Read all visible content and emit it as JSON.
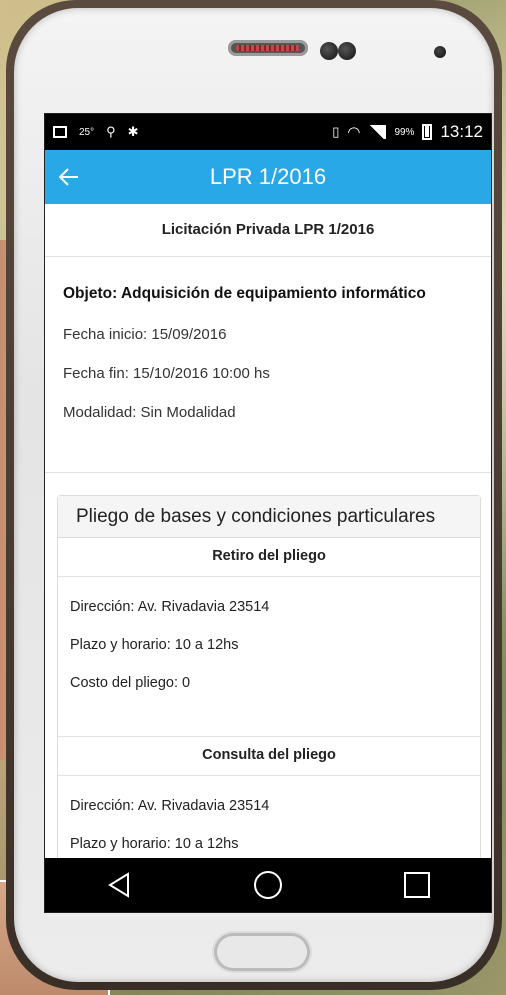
{
  "statusbar": {
    "temp": "25°",
    "battery": "99%",
    "time": "13:12"
  },
  "appbar": {
    "title": "LPR 1/2016"
  },
  "header": {
    "subtitle": "Licitación Privada LPR 1/2016"
  },
  "details": {
    "objeto": "Objeto: Adquisición de equipamiento informático",
    "fecha_inicio": "Fecha inicio: 15/09/2016",
    "fecha_fin": "Fecha fin: 15/10/2016 10:00 hs",
    "modalidad": "Modalidad: Sin Modalidad"
  },
  "pliego": {
    "title": "Pliego de bases y condiciones particulares",
    "retiro": {
      "title": "Retiro del pliego",
      "direccion": "Dirección: Av. Rivadavia 23514",
      "plazo": "Plazo y horario: 10 a 12hs",
      "costo": "Costo del pliego: 0"
    },
    "consulta": {
      "title": "Consulta del pliego",
      "direccion": "Dirección: Av. Rivadavia 23514",
      "plazo": "Plazo y horario: 10 a 12hs"
    }
  },
  "colors": {
    "appbar": "#29a8e8",
    "statusbar": "#000000"
  }
}
